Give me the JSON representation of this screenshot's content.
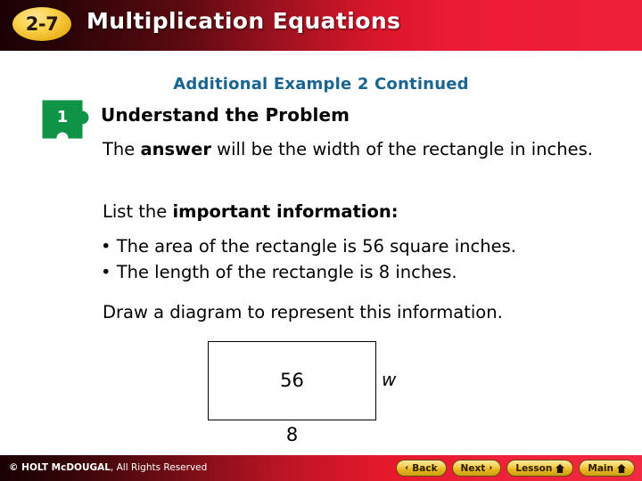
{
  "header": {
    "lesson_number": "2-7",
    "title": "Multiplication Equations"
  },
  "slide": {
    "subtitle": "Additional Example 2 Continued",
    "step_number": "1",
    "step_title": "Understand the Problem",
    "paragraphs": {
      "answer_line_pre": "The ",
      "answer_line_bold": "answer",
      "answer_line_post": " will be the width of the rectangle in inches.",
      "list_line_pre": "List the ",
      "list_line_bold": "important information:",
      "bullet_1": "• The area of the rectangle is 56 square inches.",
      "bullet_2": "• The length of the rectangle is 8 inches.",
      "draw_line": "Draw a diagram to represent this information."
    },
    "diagram": {
      "area_label": "56",
      "width_label": "w",
      "length_label": "8"
    }
  },
  "footer": {
    "copyright_bold": "© HOLT McDOUGAL",
    "copyright_rest": ", All Rights Reserved",
    "buttons": [
      {
        "label": "Back",
        "chevron": "‹",
        "chevron_side": "left",
        "home": false
      },
      {
        "label": "Next",
        "chevron": "›",
        "chevron_side": "right",
        "home": false
      },
      {
        "label": "Lesson",
        "chevron": "",
        "chevron_side": "none",
        "home": true
      },
      {
        "label": "Main",
        "chevron": "",
        "chevron_side": "none",
        "home": true
      }
    ]
  },
  "colors": {
    "header_red": "#ee2038",
    "header_dark": "#1a0204",
    "badge_gold": "#fbd24a",
    "subtitle_blue": "#1a6590",
    "puzzle_green": "#0f9347",
    "button_gold": "#f7d25a"
  }
}
